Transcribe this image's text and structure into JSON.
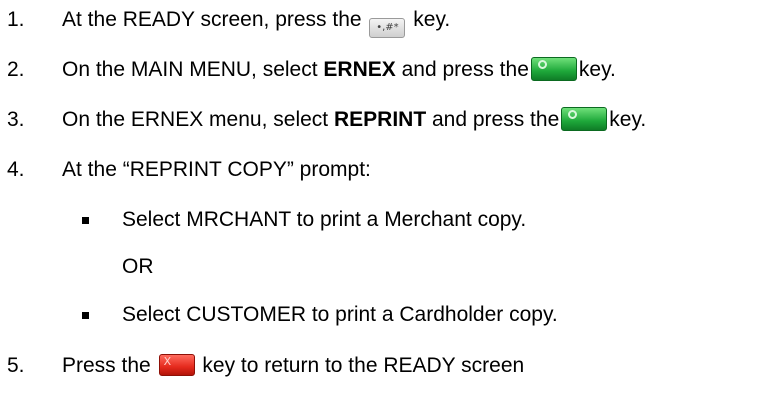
{
  "steps": [
    {
      "number": "1.",
      "parts": [
        "At the READY screen, press the",
        "key."
      ],
      "key_icon": "hash-key-icon",
      "key_label": "•,#*"
    },
    {
      "number": "2.",
      "parts": [
        "On the MAIN MENU, select",
        "ERNEX",
        "and press the",
        "key."
      ],
      "key_icon": "green-enter-key-icon"
    },
    {
      "number": "3.",
      "parts": [
        "On the ERNEX menu, select",
        "REPRINT",
        "and press the",
        "key."
      ],
      "key_icon": "green-enter-key-icon"
    },
    {
      "number": "4.",
      "text": "At the “REPRINT COPY” prompt:"
    },
    {
      "number": "5.",
      "parts": [
        "Press the",
        "key to return to the READY screen"
      ],
      "key_icon": "red-cancel-key-icon"
    }
  ],
  "sub_options": [
    "Select MRCHANT to print a Merchant copy.",
    "OR",
    "Select CUSTOMER to print a Cardholder copy."
  ],
  "colors": {
    "green_key": "#1ea83a",
    "red_key": "#e52a1d",
    "text": "#000000"
  }
}
